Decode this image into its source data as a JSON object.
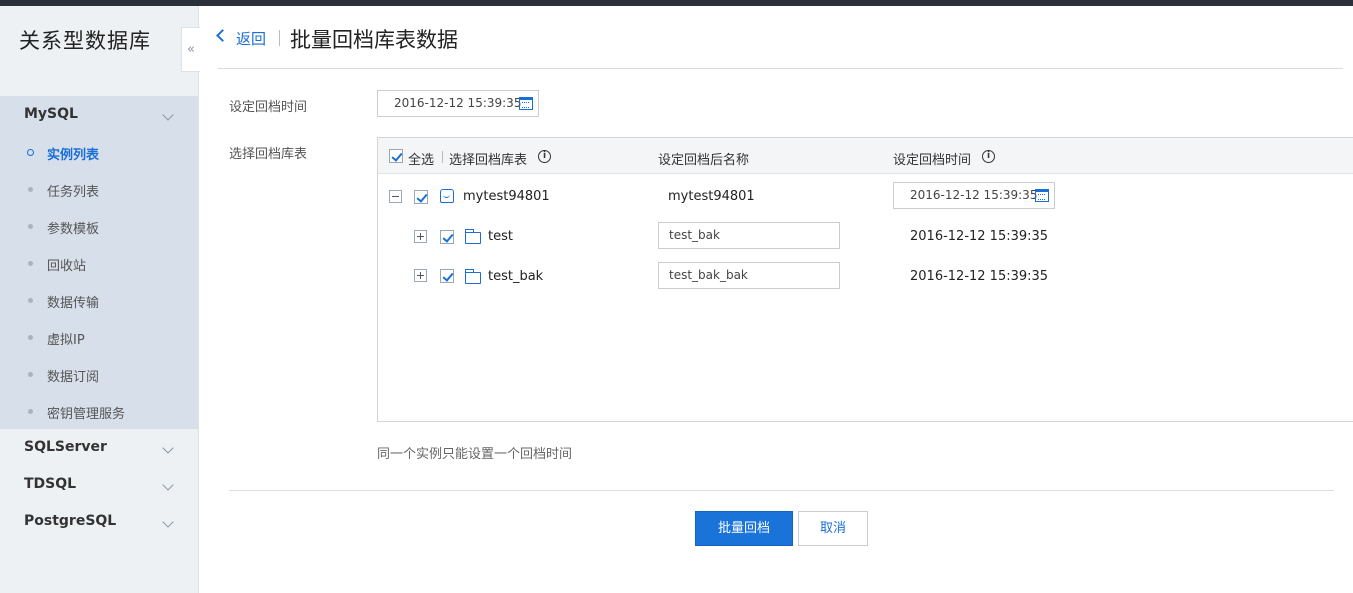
{
  "sidebar": {
    "title": "关系型数据库",
    "collapse_glyph": "«",
    "groups": [
      {
        "label": "MySQL"
      },
      {
        "label": "SQLServer"
      },
      {
        "label": "TDSQL"
      },
      {
        "label": "PostgreSQL"
      }
    ],
    "mysql_items": [
      {
        "label": "实例列表"
      },
      {
        "label": "任务列表"
      },
      {
        "label": "参数模板"
      },
      {
        "label": "回收站"
      },
      {
        "label": "数据传输"
      },
      {
        "label": "虚拟IP"
      },
      {
        "label": "数据订阅"
      },
      {
        "label": "密钥管理服务"
      }
    ]
  },
  "header": {
    "back_label": "返回",
    "title": "批量回档库表数据"
  },
  "form": {
    "rollback_time_label": "设定回档时间",
    "rollback_time_value": "2016-12-12 15:39:35",
    "select_tables_label": "选择回档库表"
  },
  "table": {
    "select_all_label": "全选",
    "col_tables": "选择回档库表",
    "col_new_name": "设定回档后名称",
    "col_time": "设定回档时间",
    "rows": [
      {
        "name": "mytest94801",
        "new_name": "mytest94801",
        "time": "2016-12-12 15:39:35"
      },
      {
        "name": "test",
        "new_name": "test_bak",
        "time": "2016-12-12 15:39:35"
      },
      {
        "name": "test_bak",
        "new_name": "test_bak_bak",
        "time": "2016-12-12 15:39:35"
      }
    ]
  },
  "hint": "同一个实例只能设置一个回档时间",
  "buttons": {
    "submit": "批量回档",
    "cancel": "取消"
  },
  "colors": {
    "accent": "#1a6fd6",
    "primary_button": "#1a73d9",
    "sidebar_bg": "#eef1f4",
    "sidebar_active_group_bg": "#d6dfea"
  }
}
